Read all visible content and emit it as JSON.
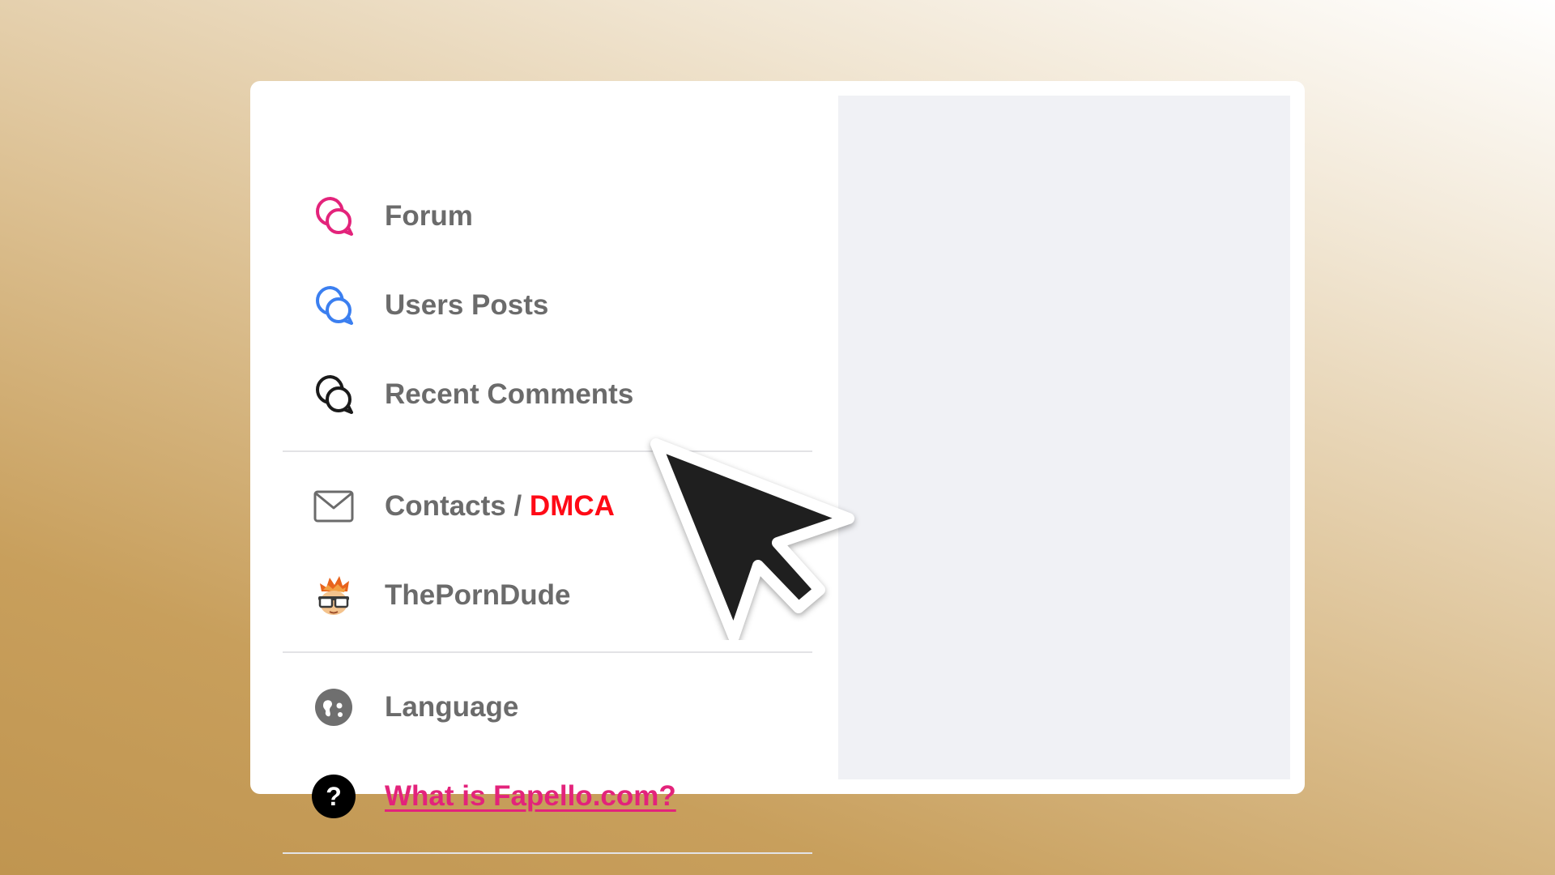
{
  "menu": {
    "items": [
      {
        "id": "forum",
        "label": "Forum",
        "icon": "chat-bubbles-icon",
        "color": "#e3237b"
      },
      {
        "id": "users-posts",
        "label": "Users Posts",
        "icon": "chat-bubbles-icon",
        "color": "#3b7ff0"
      },
      {
        "id": "recent-comments",
        "label": "Recent Comments",
        "icon": "chat-bubbles-icon",
        "color": "#1a1a1a"
      },
      {
        "id": "contacts",
        "label": "Contacts / ",
        "label_highlight": "DMCA",
        "icon": "envelope-icon",
        "highlight_color": "#ff0a16"
      },
      {
        "id": "theporndude",
        "label": "ThePornDude",
        "icon": "cartoon-face-avatar-icon"
      },
      {
        "id": "language",
        "label": "Language",
        "icon": "language-icon"
      },
      {
        "id": "about",
        "label": "What is Fapello.com?",
        "icon": "question-mark-icon",
        "color": "#e3237b"
      }
    ]
  },
  "pointer": {
    "icon": "mouse-pointer-arrow-icon",
    "color": "#1f1f1f"
  }
}
